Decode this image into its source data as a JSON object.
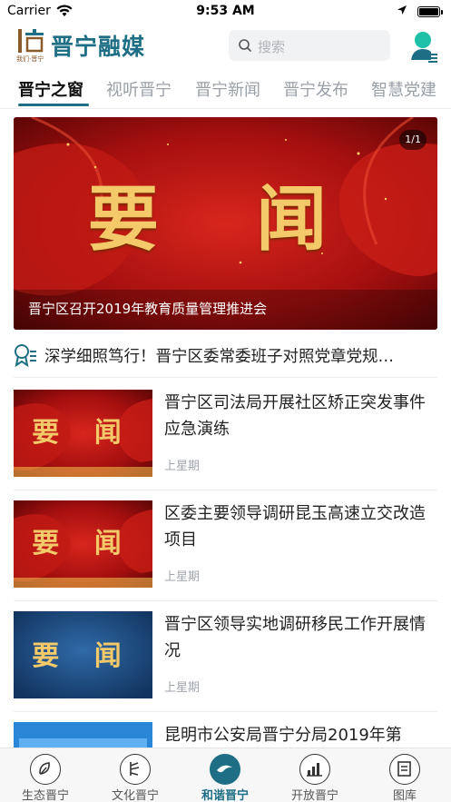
{
  "status_bar": {
    "carrier": "Carrier",
    "time": "9:53 AM"
  },
  "header": {
    "logo_small_text": "我们·晋宁",
    "brand": "晋宁融媒",
    "search_placeholder": "搜索"
  },
  "tabs": [
    {
      "label": "晋宁之窗",
      "active": true
    },
    {
      "label": "视听晋宁",
      "active": false
    },
    {
      "label": "晋宁新闻",
      "active": false
    },
    {
      "label": "晋宁发布",
      "active": false
    },
    {
      "label": "智慧党建",
      "active": false
    }
  ],
  "banner": {
    "image_text": "要 闻",
    "page_indicator": "1/1",
    "caption": "晋宁区召开2019年教育质量管理推进会"
  },
  "notice": {
    "text": "深学细照笃行！晋宁区委常委班子对照党章党规…"
  },
  "news": [
    {
      "title": "晋宁区司法局开展社区矫正突发事件应急演练",
      "meta": "上星期",
      "thumb_text": "要 闻",
      "thumb_style": "red"
    },
    {
      "title": "区委主要领导调研昆玉高速立交改造项目",
      "meta": "上星期",
      "thumb_text": "要 闻",
      "thumb_style": "red"
    },
    {
      "title": "晋宁区领导实地调研移民工作开展情况",
      "meta": "上星期",
      "thumb_text": "要 闻",
      "thumb_style": "blue"
    },
    {
      "title": "昆明市公安局晋宁分局2019年第",
      "meta": "",
      "thumb_text": "",
      "thumb_style": "poster"
    }
  ],
  "bottom_nav": [
    {
      "label": "生态晋宁",
      "icon": "eco-icon",
      "active": false
    },
    {
      "label": "文化晋宁",
      "icon": "culture-icon",
      "active": false
    },
    {
      "label": "和谐晋宁",
      "icon": "harmony-icon",
      "active": true
    },
    {
      "label": "开放晋宁",
      "icon": "open-chart-icon",
      "active": false
    },
    {
      "label": "图库",
      "icon": "gallery-icon",
      "active": false
    }
  ],
  "colors": {
    "accent": "#1e6f86",
    "banner_red": "#a80d0d",
    "gold": "#f3c96a",
    "thumb_blue": "#1c4a80"
  }
}
